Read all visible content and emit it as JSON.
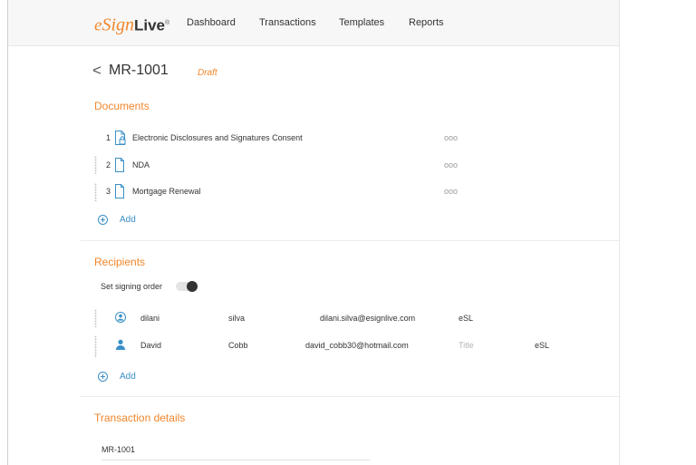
{
  "app": {
    "logo": {
      "e": "e",
      "sign": "Sign",
      "live": "Live",
      "tm": "®"
    }
  },
  "nav": {
    "items": [
      {
        "label": "Dashboard"
      },
      {
        "label": "Transactions"
      },
      {
        "label": "Templates"
      },
      {
        "label": "Reports"
      }
    ]
  },
  "header": {
    "back_glyph": "<",
    "title": "MR-1001",
    "status": "Draft"
  },
  "documents": {
    "title": "Documents",
    "items": [
      {
        "number": "1",
        "name": "Electronic Disclosures and Signatures Consent",
        "more": "ooo",
        "icon": "document-locked-icon"
      },
      {
        "number": "2",
        "name": "NDA",
        "more": "ooo",
        "icon": "document-icon"
      },
      {
        "number": "3",
        "name": "Mortgage Renewal",
        "more": "ooo",
        "icon": "document-icon"
      }
    ],
    "add_label": "Add"
  },
  "recipients": {
    "title": "Recipients",
    "signing_order_label": "Set signing order",
    "signing_order_enabled": false,
    "items": [
      {
        "first": "dilani",
        "last": "silva",
        "email": "dilani.silva@esignlive.com",
        "title": "",
        "company": "eSL",
        "icon": "sender-user-icon"
      },
      {
        "first": "David",
        "last": "Cobb",
        "email": "david_cobb30@hotmail.com",
        "title": "Title",
        "company": "eSL",
        "icon": "user-icon"
      }
    ],
    "add_label": "Add"
  },
  "transaction_details": {
    "title": "Transaction details",
    "name_value": "MR-1001"
  },
  "colors": {
    "accent": "#f2862b",
    "link": "#3a8fc7",
    "icon_blue": "#3a8fc7"
  }
}
